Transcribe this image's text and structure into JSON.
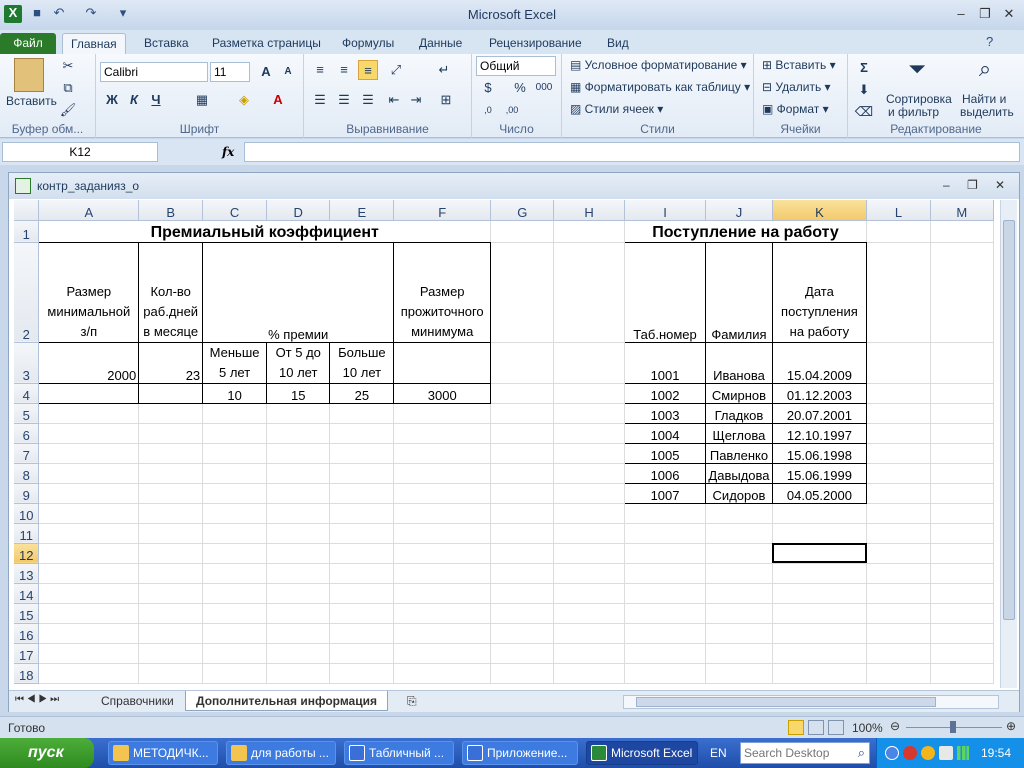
{
  "app": {
    "title": "Microsoft Excel"
  },
  "tabs": [
    "Файл",
    "Главная",
    "Вставка",
    "Разметка страницы",
    "Формулы",
    "Данные",
    "Рецензирование",
    "Вид"
  ],
  "ribbon": {
    "paste": "Вставить",
    "font_name": "Calibri",
    "font_size": "11",
    "bold": "Ж",
    "italic": "К",
    "underline": "Ч",
    "number_format": "Общий",
    "cond_format": "Условное форматирование",
    "format_table": "Форматировать как таблицу",
    "cell_styles": "Стили ячеек",
    "insert": "Вставить",
    "delete": "Удалить",
    "format": "Формат",
    "sort_filter_1": "Сортировка",
    "sort_filter_2": "и фильтр",
    "find_1": "Найти и",
    "find_2": "выделить",
    "groups": {
      "clipboard": "Буфер обм...",
      "font": "Шрифт",
      "alignment": "Выравнивание",
      "number": "Число",
      "styles": "Стили",
      "cells": "Ячейки",
      "editing": "Редактирование"
    }
  },
  "formula_bar": {
    "name_box": "K12",
    "fx": "fx",
    "formula": ""
  },
  "workbook": {
    "title": "контр_заданияз_о"
  },
  "columns": [
    "A",
    "B",
    "C",
    "D",
    "E",
    "F",
    "G",
    "H",
    "I",
    "J",
    "K",
    "L",
    "M"
  ],
  "selected_col": "K",
  "selected_row": "12",
  "cells": {
    "title1": "Премиальный коэффициент",
    "title2": "Поступление на работу",
    "a2": "Размер минимальной з/п",
    "b2": "Кол-во раб.дней в месяце",
    "cde2": "% премии",
    "f2": "Размер прожиточного минимума",
    "i2": "Таб.номер",
    "j2": "Фамилия",
    "k2": "Дата поступления на работу",
    "c3": "Меньше 5 лет",
    "d3": "От 5 до 10 лет",
    "e3": "Больше 10 лет",
    "a3": "2000",
    "b3": "23",
    "c4": "10",
    "d4": "15",
    "e4": "25",
    "f4": "3000"
  },
  "employees": [
    {
      "tab": "1001",
      "name": "Иванова",
      "date": "15.04.2009"
    },
    {
      "tab": "1002",
      "name": "Смирнов",
      "date": "01.12.2003"
    },
    {
      "tab": "1003",
      "name": "Гладков",
      "date": "20.07.2001"
    },
    {
      "tab": "1004",
      "name": "Щеглова",
      "date": "12.10.1997"
    },
    {
      "tab": "1005",
      "name": "Павленко",
      "date": "15.06.1998"
    },
    {
      "tab": "1006",
      "name": "Давыдова",
      "date": "15.06.1999"
    },
    {
      "tab": "1007",
      "name": "Сидоров",
      "date": "04.05.2000"
    }
  ],
  "sheet_tabs": [
    "Справочники",
    "Дополнительная информация"
  ],
  "status": {
    "ready": "Готово",
    "zoom": "100%"
  },
  "taskbar": {
    "start": "пуск",
    "items": [
      "МЕТОДИЧК...",
      "для работы ...",
      "Табличный ...",
      "Приложение...",
      "Microsoft Excel"
    ],
    "lang": "EN",
    "search_placeholder": "Search Desktop",
    "clock": "19:54"
  }
}
